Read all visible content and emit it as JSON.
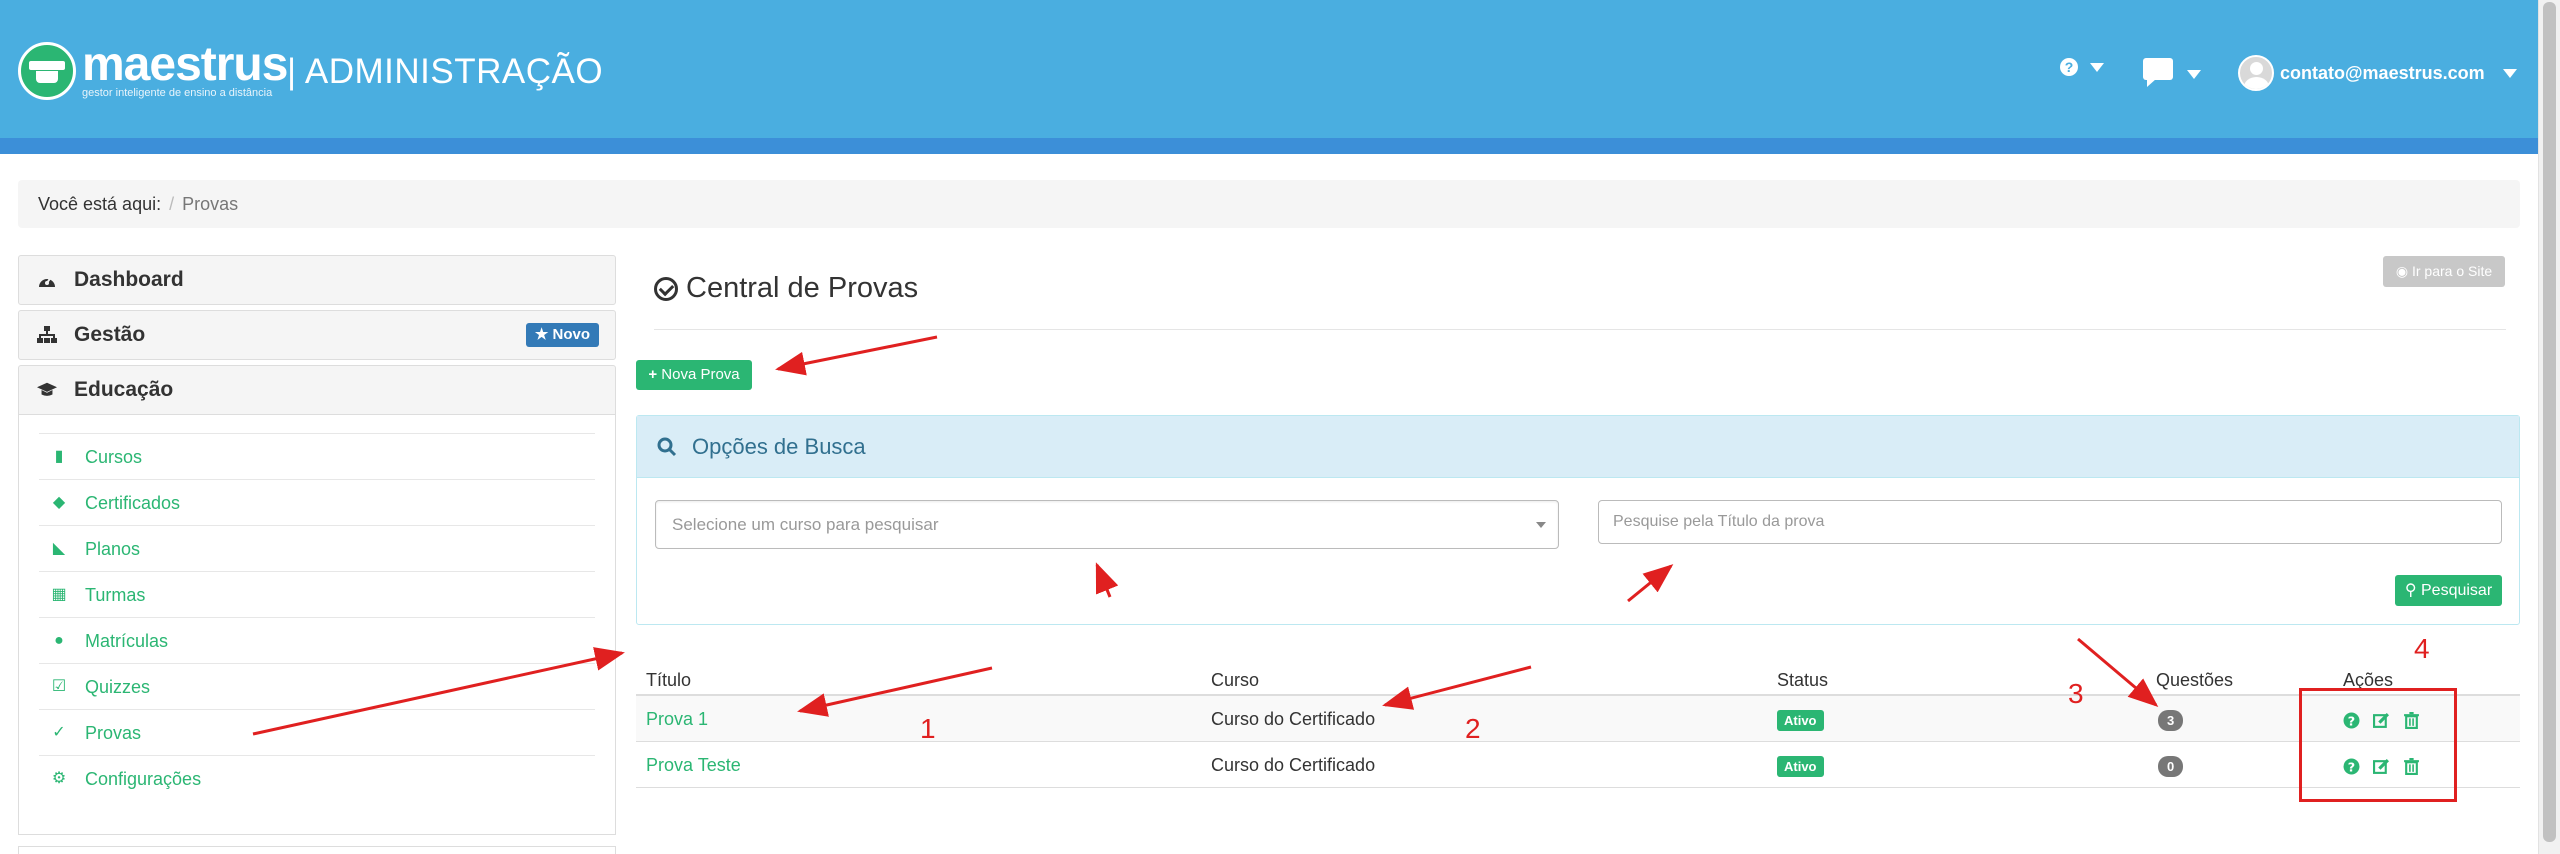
{
  "app": {
    "logo_word": "maestrus",
    "logo_tagline": "gestor inteligente de ensino a distância",
    "section_title": "| ADMINISTRAÇÃO"
  },
  "topnav": {
    "help_icon": "question-circle-icon",
    "chat_icon": "comment-icon",
    "user_email": "contato@maestrus.com"
  },
  "breadcrumb": {
    "prefix": "Você está aqui:",
    "separator": "/",
    "current": "Provas"
  },
  "sidebar": {
    "dashboard": "Dashboard",
    "gestao": "Gestão",
    "gestao_badge": "Novo",
    "educacao": "Educação",
    "items": [
      {
        "label": "Cursos",
        "icon": "book-icon"
      },
      {
        "label": "Certificados",
        "icon": "graduation-cap-icon"
      },
      {
        "label": "Planos",
        "icon": "tags-icon"
      },
      {
        "label": "Turmas",
        "icon": "calendar-icon"
      },
      {
        "label": "Matrículas",
        "icon": "user-icon"
      },
      {
        "label": "Quizzes",
        "icon": "check-square-icon"
      },
      {
        "label": "Provas",
        "icon": "check-circle-icon"
      },
      {
        "label": "Configurações",
        "icon": "cogs-icon"
      }
    ]
  },
  "main": {
    "title": "Central de Provas",
    "site_button": "Ir para o Site",
    "new_button": "Nova Prova",
    "search": {
      "title": "Opções de Busca",
      "course_placeholder": "Selecione um curso para pesquisar",
      "title_placeholder": "Pesquise pela Título da prova",
      "button": "Pesquisar"
    },
    "table": {
      "headers": [
        "Título",
        "Curso",
        "Status",
        "Questões",
        "Ações"
      ],
      "rows": [
        {
          "titulo": "Prova 1",
          "curso": "Curso do Certificado",
          "status": "Ativo",
          "questoes": "3"
        },
        {
          "titulo": "Prova Teste",
          "curso": "Curso do Certificado",
          "status": "Ativo",
          "questoes": "0"
        }
      ]
    }
  },
  "annotations": [
    "1",
    "2",
    "3",
    "4"
  ],
  "colors": {
    "header": "#4aaee0",
    "header_strip": "#3c8fd8",
    "accent_green": "#2bb673",
    "badge_blue": "#337ab7",
    "annotation_red": "#e02020"
  }
}
